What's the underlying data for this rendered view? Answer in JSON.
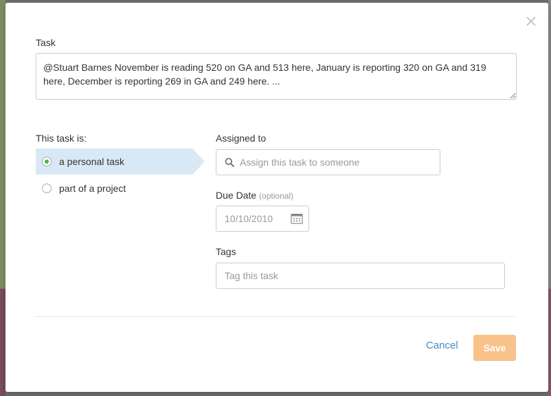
{
  "modal": {
    "task_label": "Task",
    "task_text": "@Stuart Barnes November is reading 520 on GA and 513 here, January is reporting 320 on GA and 319 here, December is reporting 269 in GA and 249 here. ...",
    "this_task_is_label": "This task is:",
    "options": [
      {
        "label": "a personal task",
        "selected": true
      },
      {
        "label": "part of a project",
        "selected": false
      }
    ],
    "assigned_label": "Assigned to",
    "assign_placeholder": "Assign this task to someone",
    "due_label": "Due Date",
    "due_optional": "(optional)",
    "due_placeholder": "10/10/2010",
    "tags_label": "Tags",
    "tags_placeholder": "Tag this task",
    "cancel_label": "Cancel",
    "save_label": "Save"
  },
  "colors": {
    "accent_blue": "#3f8dc4",
    "save_disabled": "#f9c28a",
    "radio_selected": "#4caf50",
    "selected_row_bg": "#d9e8f5"
  },
  "icons": {
    "close": "close-icon",
    "search": "search-icon",
    "calendar": "calendar-icon"
  }
}
